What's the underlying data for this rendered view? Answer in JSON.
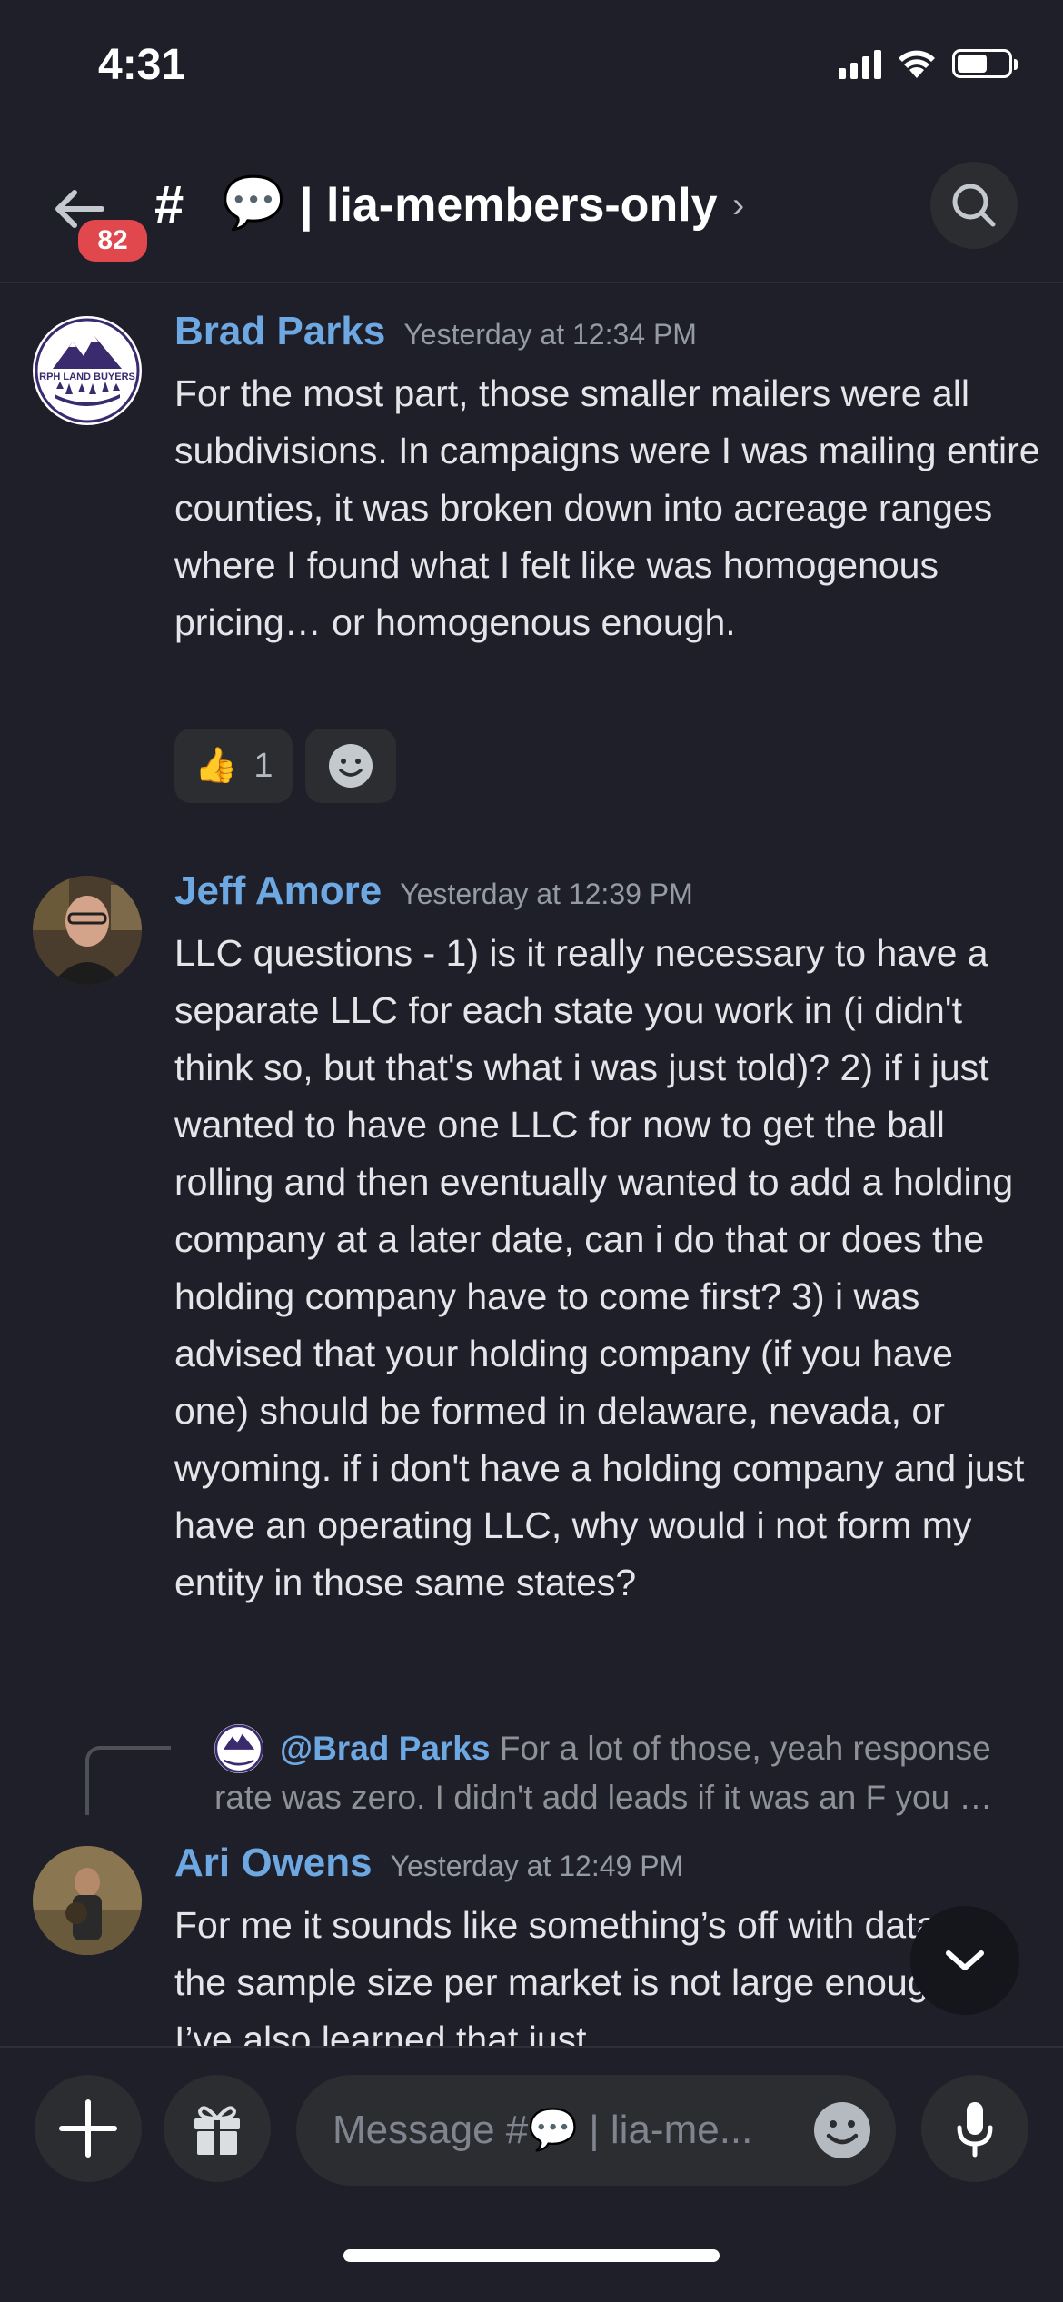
{
  "status_bar": {
    "time": "4:31"
  },
  "header": {
    "badge_count": "82",
    "hash": "#",
    "channel_emoji": "💬",
    "channel_name": "| lia-members-only",
    "chevron": "›"
  },
  "messages": [
    {
      "author": "Brad Parks",
      "timestamp": "Yesterday at 12:34 PM",
      "avatar_text": "RPH LAND BUYERS",
      "text": "For the most part, those smaller mailers were all subdivisions. In campaigns were I was mailing entire counties, it was broken down into acreage ranges where I found what I felt like was homogenous pricing… or homogenous enough.",
      "reactions": [
        {
          "emoji": "👍",
          "count": "1"
        }
      ]
    },
    {
      "author": "Jeff Amore",
      "timestamp": "Yesterday at 12:39 PM",
      "text": "LLC questions - 1) is it really necessary to have a separate LLC for each state you work in (i didn't think so, but that's what i was just told)? 2) if i just wanted to have one LLC for now to get the ball rolling and then eventually wanted to add a holding company at a later date, can i do that or does the holding company have to come first? 3) i was advised that your holding company (if you have one) should be formed in delaware, nevada, or wyoming. if i don't have a holding company and just have an operating LLC, why would i not form my entity in those same states?"
    },
    {
      "reply_to": "@Brad Parks",
      "reply_preview": "For a lot of those, yeah response rate was zero. I didn't add leads if it was an F you …",
      "author": "Ari Owens",
      "timestamp": "Yesterday at 12:49 PM",
      "text": "For me it sounds like something’s off with data, or the sample size per market is not large enough. I’ve also learned that just"
    }
  ],
  "composer": {
    "placeholder": "Message #💬 | lia-me..."
  }
}
